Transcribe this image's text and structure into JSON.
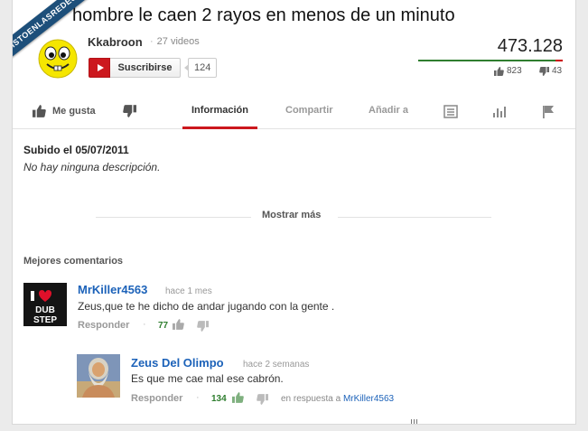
{
  "watermark": "VISTOENLASREDES.COM",
  "video": {
    "title": "hombre le caen 2 rayos en menos de un minuto",
    "views": "473.128",
    "likes": "823",
    "dislikes": "43",
    "like_ratio": 0.95
  },
  "channel": {
    "name": "Kkabroon",
    "videos": "27 videos",
    "subscribe_label": "Suscribirse",
    "subscriber_count": "124"
  },
  "tabs": {
    "like": "Me gusta",
    "info": "Información",
    "share": "Compartir",
    "add": "Añadir a"
  },
  "info": {
    "uploaded": "Subido el 05/07/2011",
    "description": "No hay ninguna descripción.",
    "show_more": "Mostrar más"
  },
  "comments": {
    "header": "Mejores comentarios",
    "items": [
      {
        "author": "MrKiller4563",
        "time": "hace 1 mes",
        "text": "Zeus,que te he dicho de andar jugando con la gente .",
        "reply_label": "Responder",
        "votes": "77",
        "avatar_text": "DUB STEP"
      },
      {
        "author": "Zeus Del Olimpo",
        "time": "hace 2 semanas",
        "text": "Es que me cae mal ese cabrón.",
        "reply_label": "Responder",
        "votes": "134",
        "in_reply_prefix": "en respuesta a",
        "in_reply_to": "MrKiller4563"
      }
    ]
  },
  "colors": {
    "accent_red": "#cc181e",
    "link_blue": "#1c62b9",
    "like_green": "#2f7e2f",
    "watermark_blue": "#1d4f7a"
  }
}
